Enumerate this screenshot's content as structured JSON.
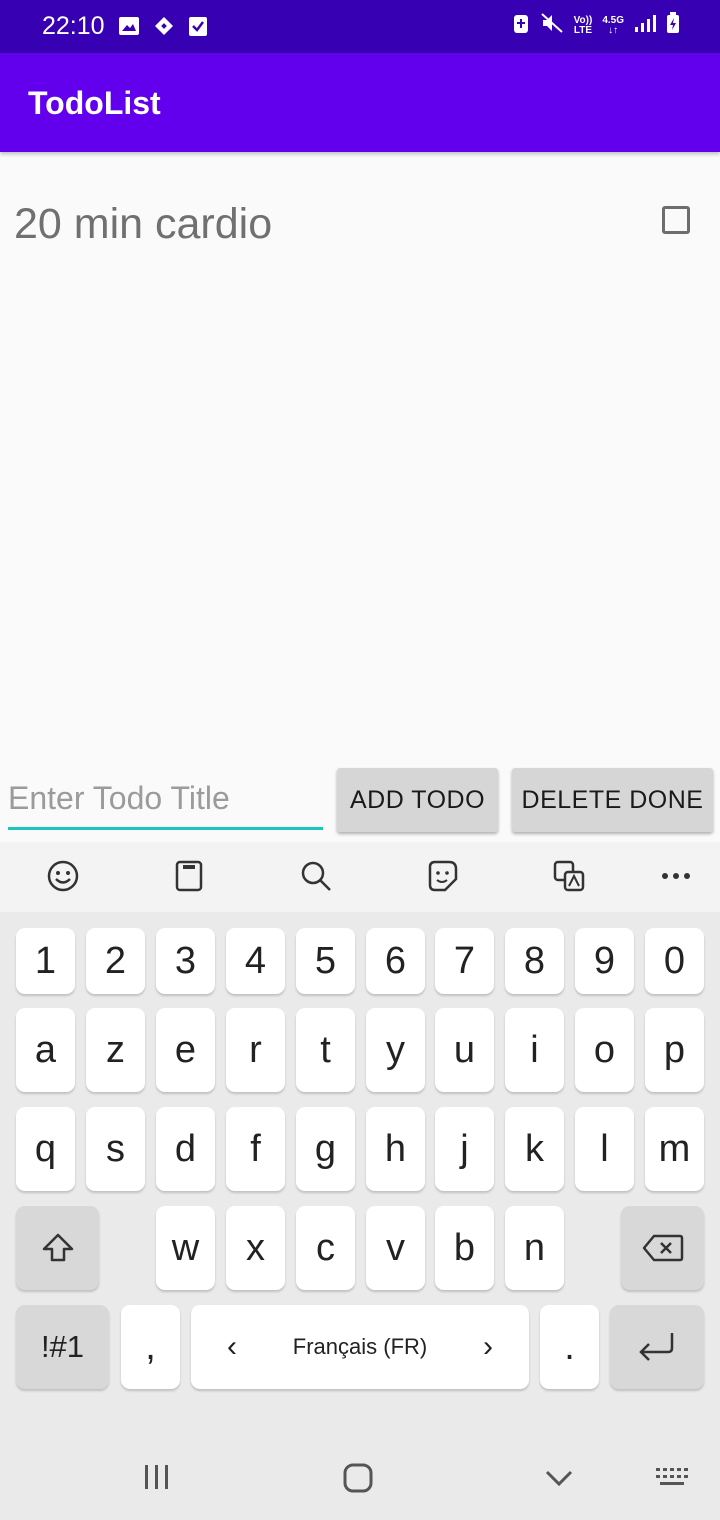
{
  "status": {
    "time": "22:10",
    "network_label_top": "Vo)) ",
    "network_label_bottom": "LTE",
    "network_gen": "4.5G"
  },
  "app": {
    "title": "TodoList"
  },
  "todos": [
    {
      "title": "20 min cardio",
      "done": false
    }
  ],
  "input": {
    "value": "",
    "placeholder": "Enter Todo Title"
  },
  "buttons": {
    "add": "ADD TODO",
    "delete": "DELETE DONE"
  },
  "keyboard": {
    "toolbar_icons": [
      "emoji-icon",
      "clipboard-icon",
      "search-icon",
      "sticker-icon",
      "translate-icon",
      "more-icon"
    ],
    "row1": [
      "1",
      "2",
      "3",
      "4",
      "5",
      "6",
      "7",
      "8",
      "9",
      "0"
    ],
    "row2": [
      "a",
      "z",
      "e",
      "r",
      "t",
      "y",
      "u",
      "i",
      "o",
      "p"
    ],
    "row3": [
      "q",
      "s",
      "d",
      "f",
      "g",
      "h",
      "j",
      "k",
      "l",
      "m"
    ],
    "row4": [
      "w",
      "x",
      "c",
      "v",
      "b",
      "n"
    ],
    "symbols": "!#1",
    "comma": ",",
    "period": ".",
    "space_label": "Français (FR)",
    "space_left": "‹",
    "space_right": "›"
  },
  "colors": {
    "status_bar": "#3700b3",
    "app_bar": "#6200ee",
    "accent": "#1ac6c0"
  }
}
